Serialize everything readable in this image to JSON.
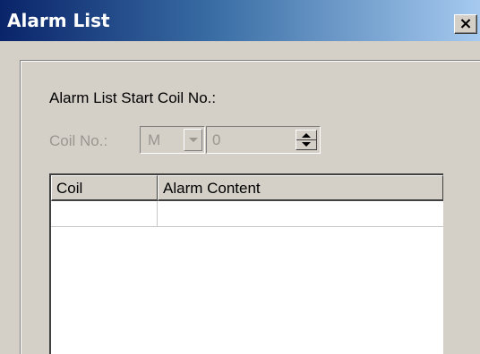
{
  "window": {
    "title": "Alarm List",
    "close_glyph": "×"
  },
  "form": {
    "start_label": "Alarm List Start Coil No.:",
    "coil_label": "Coil No.:",
    "coil_type_value": "M",
    "coil_number_value": "0"
  },
  "table": {
    "columns": [
      "Coil",
      "Alarm Content"
    ],
    "rows": [
      {
        "coil": "",
        "content": ""
      }
    ]
  },
  "colors": {
    "title_gradient_start": "#0a246a",
    "title_gradient_end": "#a6caf0",
    "face": "#d4d0c8",
    "disabled_text": "#9a9690"
  }
}
